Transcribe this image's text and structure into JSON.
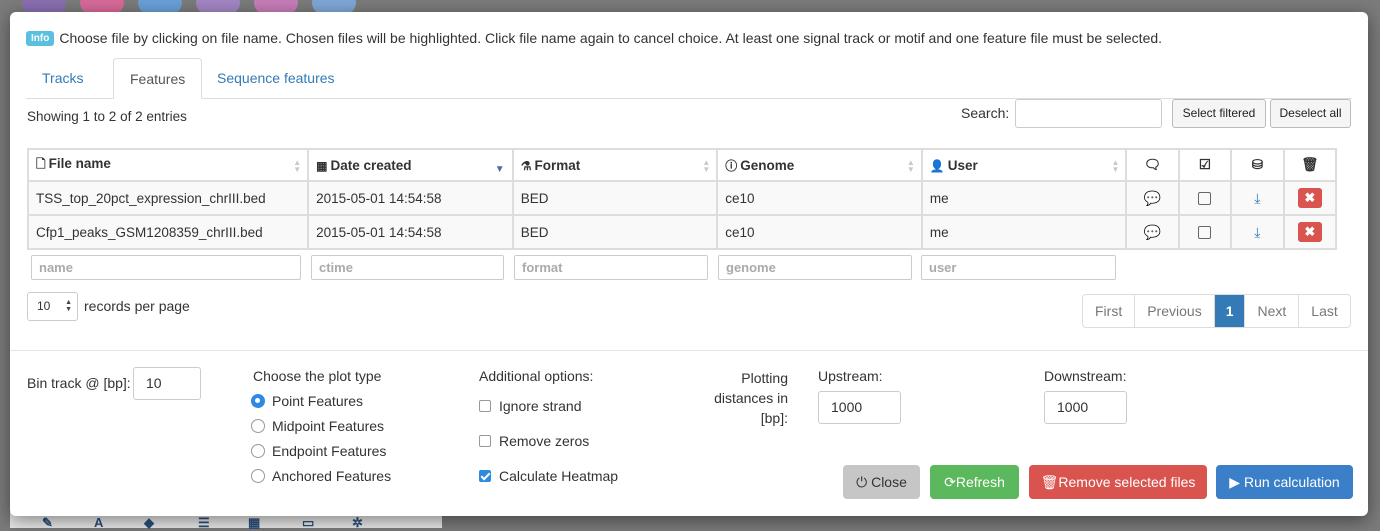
{
  "info": {
    "badge": "Info",
    "message": "Choose file by clicking on file name. Chosen files will be highlighted. Click file name again to cancel choice. At least one signal track or motif and one feature file must be selected."
  },
  "tabs": [
    {
      "label": "Tracks"
    },
    {
      "label": "Features"
    },
    {
      "label": "Sequence features"
    }
  ],
  "table_info": {
    "showing": "Showing 1 to 2 of 2 entries",
    "search_label": "Search:",
    "search_value": "",
    "select_filtered": "Select filtered",
    "deselect_all": "Deselect all"
  },
  "columns": [
    {
      "label": "File name",
      "icon": "file-icon"
    },
    {
      "label": "Date created",
      "icon": "calendar-icon"
    },
    {
      "label": "Format",
      "icon": "flask-icon"
    },
    {
      "label": "Genome",
      "icon": "info-icon"
    },
    {
      "label": "User",
      "icon": "user-icon"
    }
  ],
  "icon_columns": [
    "comment-icon",
    "check-square-icon",
    "hdd-icon",
    "trash-icon"
  ],
  "rows": [
    {
      "name": "TSS_top_20pct_expression_chrIII.bed",
      "date": "2015-05-01 14:54:58",
      "format": "BED",
      "genome": "ce10",
      "user": "me"
    },
    {
      "name": "Cfp1_peaks_GSM1208359_chrIII.bed",
      "date": "2015-05-01 14:54:58",
      "format": "BED",
      "genome": "ce10",
      "user": "me"
    }
  ],
  "filters": {
    "name": "name",
    "ctime": "ctime",
    "format": "format",
    "genome": "genome",
    "user": "user"
  },
  "records": {
    "value": "10",
    "label": "records per page"
  },
  "pagination": {
    "first": "First",
    "previous": "Previous",
    "current": "1",
    "next": "Next",
    "last": "Last"
  },
  "options": {
    "bin_label": "Bin track @ [bp]:",
    "bin_value": "10",
    "plot_type_label": "Choose the plot type",
    "plot_types": [
      {
        "label": "Point Features",
        "selected": true
      },
      {
        "label": "Midpoint Features",
        "selected": false
      },
      {
        "label": "Endpoint Features",
        "selected": false
      },
      {
        "label": "Anchored Features",
        "selected": false
      }
    ],
    "additional_label": "Additional options:",
    "additional": [
      {
        "label": "Ignore strand",
        "checked": false
      },
      {
        "label": "Remove zeros",
        "checked": false
      },
      {
        "label": "Calculate Heatmap",
        "checked": true
      }
    ],
    "plotting_distances_label": "Plotting distances in [bp]:",
    "upstream_label": "Upstream:",
    "upstream_value": "1000",
    "downstream_label": "Downstream:",
    "downstream_value": "1000"
  },
  "buttons": {
    "close": "Close",
    "refresh": "Refresh",
    "remove": "Remove selected files",
    "run": "Run calculation"
  },
  "colors": {
    "primary": "#337ab7",
    "success": "#5cb85c",
    "danger": "#d9534f",
    "run": "#3a7fc8",
    "info": "#5bc0de"
  }
}
